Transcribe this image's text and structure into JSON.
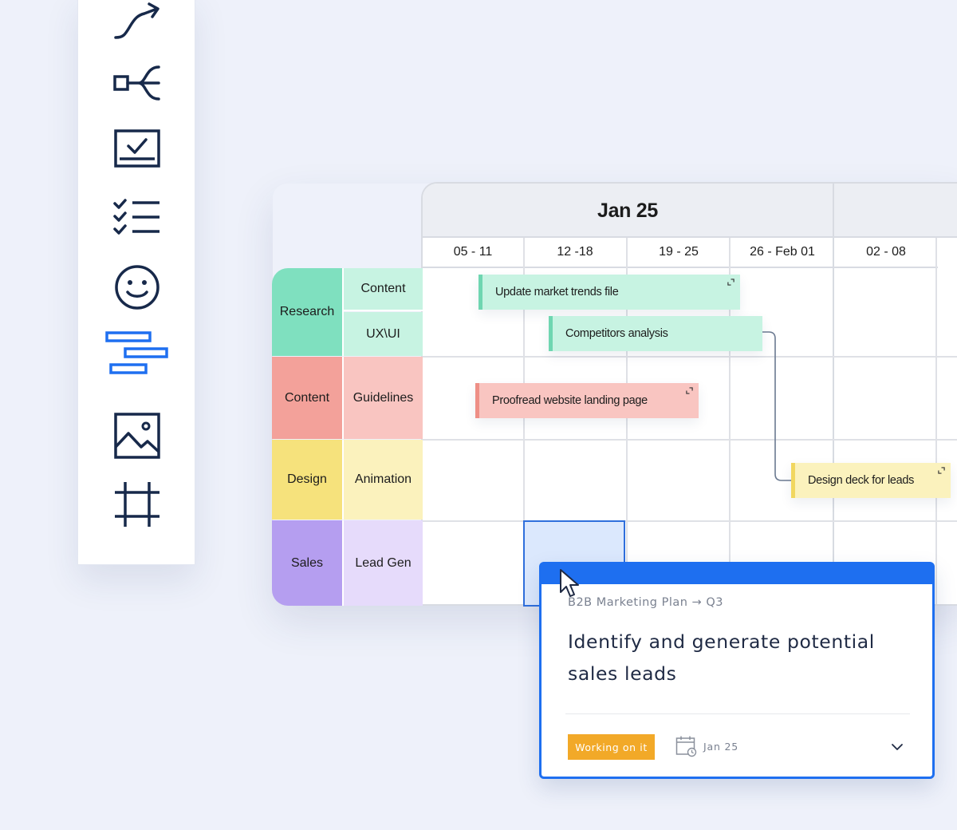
{
  "toolbar": {
    "tools": [
      {
        "icon": "connector-line-icon"
      },
      {
        "icon": "mind-map-icon"
      },
      {
        "icon": "checked-card-icon"
      },
      {
        "icon": "checklist-icon"
      },
      {
        "icon": "emoji-icon"
      },
      {
        "icon": "gantt-chart-icon",
        "active": true
      },
      {
        "icon": "image-icon"
      },
      {
        "icon": "frame-icon"
      }
    ]
  },
  "timeline": {
    "month": "Jan 25",
    "weeks": [
      "05 - 11",
      "12 -18",
      "19 - 25",
      "26 - Feb 01",
      "02 - 08"
    ]
  },
  "rows": {
    "categories": [
      {
        "label": "Research",
        "color": "#7fe0bf"
      },
      {
        "label": "Content",
        "color": "#f3a19a"
      },
      {
        "label": "Design",
        "color": "#f6e27c"
      },
      {
        "label": "Sales",
        "color": "#b59ef0"
      }
    ],
    "subcategories": [
      {
        "label": "Content",
        "color": "#c7f3e2"
      },
      {
        "label": "UX\\UI",
        "color": "#c7f3e2"
      },
      {
        "label": "Guidelines",
        "color": "#f9c5c1"
      },
      {
        "label": "Animation",
        "color": "#fbf2bd"
      },
      {
        "label": "Lead Gen",
        "color": "#e6dbfb"
      }
    ]
  },
  "tasks": [
    {
      "label": "Update market trends file",
      "color": "#c7f3e2",
      "accent": "#6fd6b1"
    },
    {
      "label": "Competitors analysis",
      "color": "#c7f3e2",
      "accent": "#6fd6b1"
    },
    {
      "label": "Proofread website landing page",
      "color": "#f9c5c1",
      "accent": "#ee8f86"
    },
    {
      "label": "Design deck for leads",
      "color": "#fbf2bd",
      "accent": "#f1d760"
    }
  ],
  "card": {
    "breadcrumb": "B2B Marketing Plan → Q3",
    "title": "Identify and generate potential sales leads",
    "status": "Working on it",
    "status_color": "#f2a928",
    "date": "Jan 25",
    "accent_color": "#1e6ff0"
  }
}
